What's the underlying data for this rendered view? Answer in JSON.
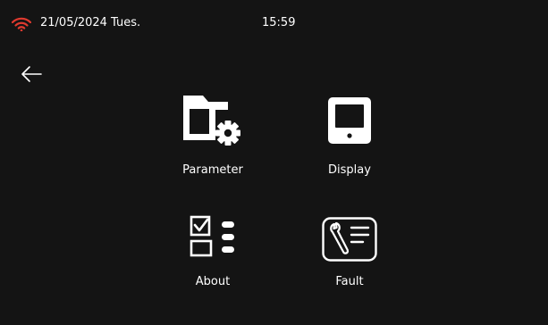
{
  "status_bar": {
    "date": "21/05/2024 Tues.",
    "time": "15:59",
    "wifi_icon": "wifi-icon",
    "wifi_color": "#e03a2f"
  },
  "nav": {
    "back_icon": "back-arrow-icon"
  },
  "menu": {
    "items": [
      {
        "label": "Parameter",
        "icon": "folder-gear-icon"
      },
      {
        "label": "Display",
        "icon": "display-icon"
      },
      {
        "label": "About",
        "icon": "checklist-icon"
      },
      {
        "label": "Fault",
        "icon": "wrench-panel-icon"
      }
    ]
  },
  "colors": {
    "background": "#141414",
    "foreground": "#ffffff"
  }
}
